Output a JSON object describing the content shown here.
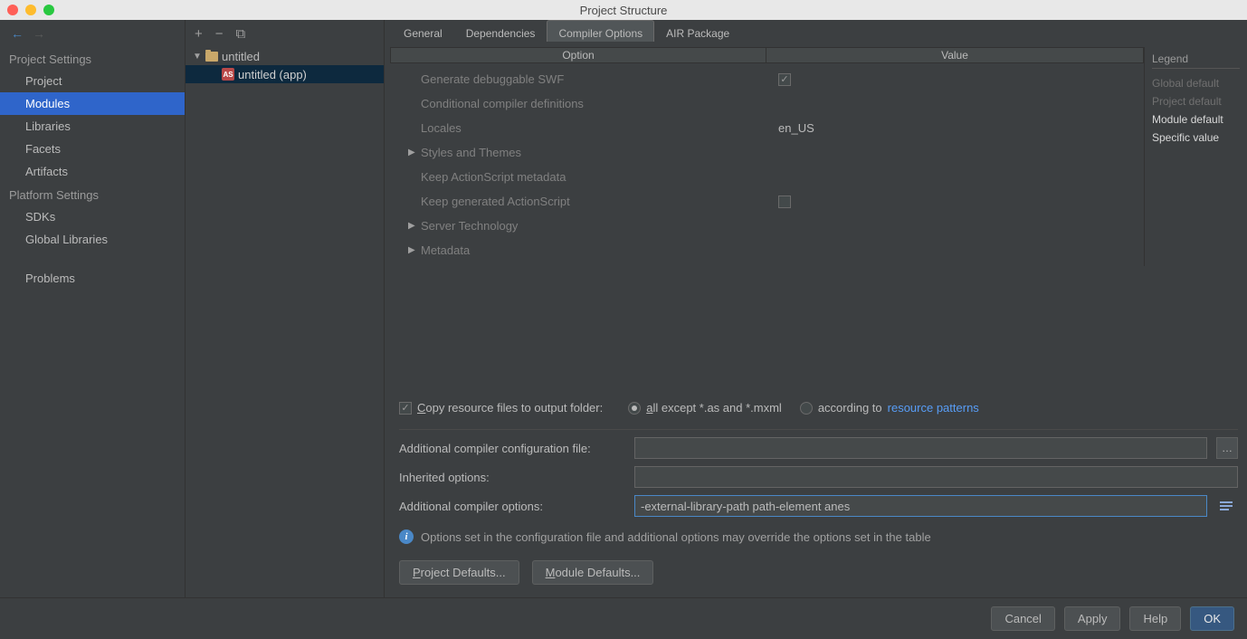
{
  "window": {
    "title": "Project Structure"
  },
  "sidebar": {
    "sections": [
      {
        "title": "Project Settings",
        "items": [
          "Project",
          "Modules",
          "Libraries",
          "Facets",
          "Artifacts"
        ],
        "selected": "Modules"
      },
      {
        "title": "Platform Settings",
        "items": [
          "SDKs",
          "Global Libraries"
        ]
      }
    ],
    "problems": "Problems"
  },
  "tree": {
    "root": {
      "label": "untitled"
    },
    "module": {
      "label": "untitled (app)"
    }
  },
  "tabs": {
    "items": [
      "General",
      "Dependencies",
      "Compiler Options",
      "AIR Package"
    ],
    "active": "Compiler Options"
  },
  "table": {
    "headers": {
      "option": "Option",
      "value": "Value"
    },
    "rows": [
      {
        "label": "Generate debuggable SWF",
        "valueType": "check",
        "checked": true
      },
      {
        "label": "Conditional compiler definitions",
        "valueType": "text",
        "value": ""
      },
      {
        "label": "Locales",
        "valueType": "text",
        "value": "en_US"
      },
      {
        "label": "Styles and Themes",
        "valueType": "expand"
      },
      {
        "label": "Keep ActionScript metadata",
        "valueType": "text",
        "value": ""
      },
      {
        "label": "Keep generated ActionScript",
        "valueType": "check",
        "checked": false
      },
      {
        "label": "Server Technology",
        "valueType": "expand"
      },
      {
        "label": "Metadata",
        "valueType": "expand"
      }
    ]
  },
  "legend": {
    "title": "Legend",
    "items": [
      {
        "label": "Global default",
        "style": "dim"
      },
      {
        "label": "Project default",
        "style": "dim"
      },
      {
        "label": "Module default",
        "style": "bright"
      },
      {
        "label": "Specific value",
        "style": "bright"
      }
    ]
  },
  "copy": {
    "label_prefix": "C",
    "label_rest": "opy resource files to output folder:",
    "radio1_prefix": "a",
    "radio1_rest": "ll except *.as and *.mxml",
    "radio2_prefix": "a",
    "radio2_rest": "ccording to",
    "link": "resource patterns"
  },
  "form": {
    "config_file_label": "Additional compiler configuration file:",
    "config_file_value": "",
    "inherited_label": "Inherited options:",
    "inherited_value": "",
    "options_label": "Additional compiler options:",
    "options_value": "-external-library-path path-element anes"
  },
  "info": "Options set in the configuration file and additional options may override the options set in the table",
  "defaults": {
    "project_prefix": "P",
    "project_rest": "roject Defaults...",
    "module_prefix": "M",
    "module_rest": "odule Defaults..."
  },
  "footer": {
    "cancel": "Cancel",
    "apply": "Apply",
    "help": "Help",
    "ok": "OK"
  }
}
